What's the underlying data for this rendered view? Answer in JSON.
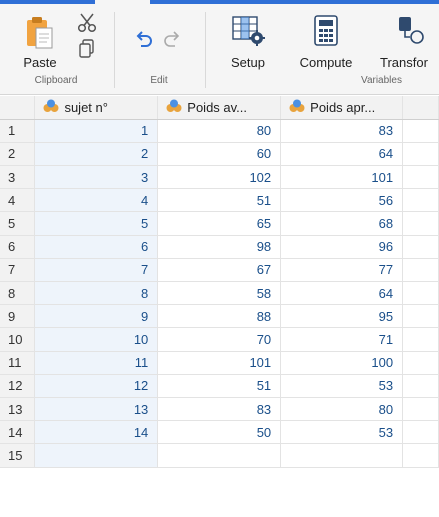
{
  "ribbon": {
    "clipboard": {
      "paste_label": "Paste",
      "group_label": "Clipboard"
    },
    "edit": {
      "group_label": "Edit"
    },
    "variables": {
      "setup_label": "Setup",
      "compute_label": "Compute",
      "transform_label": "Transfor",
      "group_label": "Variables"
    }
  },
  "colors": {
    "accent": "#2f6fd6",
    "cell_text": "#1a4f8a",
    "selected_column": "#eef4fb"
  },
  "grid": {
    "columns": [
      {
        "label": "sujet n°",
        "icon": "continuous-variable-icon"
      },
      {
        "label": "Poids av...",
        "icon": "continuous-variable-icon"
      },
      {
        "label": "Poids apr...",
        "icon": "continuous-variable-icon"
      }
    ],
    "rows": [
      {
        "n": "1",
        "a": "1",
        "b": "80",
        "c": "83"
      },
      {
        "n": "2",
        "a": "2",
        "b": "60",
        "c": "64"
      },
      {
        "n": "3",
        "a": "3",
        "b": "102",
        "c": "101"
      },
      {
        "n": "4",
        "a": "4",
        "b": "51",
        "c": "56"
      },
      {
        "n": "5",
        "a": "5",
        "b": "65",
        "c": "68"
      },
      {
        "n": "6",
        "a": "6",
        "b": "98",
        "c": "96"
      },
      {
        "n": "7",
        "a": "7",
        "b": "67",
        "c": "77"
      },
      {
        "n": "8",
        "a": "8",
        "b": "58",
        "c": "64"
      },
      {
        "n": "9",
        "a": "9",
        "b": "88",
        "c": "95"
      },
      {
        "n": "10",
        "a": "10",
        "b": "70",
        "c": "71"
      },
      {
        "n": "11",
        "a": "11",
        "b": "101",
        "c": "100"
      },
      {
        "n": "12",
        "a": "12",
        "b": "51",
        "c": "53"
      },
      {
        "n": "13",
        "a": "13",
        "b": "83",
        "c": "80"
      },
      {
        "n": "14",
        "a": "14",
        "b": "50",
        "c": "53"
      },
      {
        "n": "15",
        "a": "",
        "b": "",
        "c": ""
      }
    ]
  }
}
